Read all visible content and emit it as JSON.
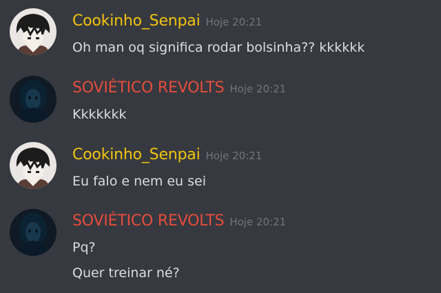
{
  "colors": {
    "background": "#36393f",
    "cookinho_name": "#f1c40f",
    "sovietico_name": "#e74c3c",
    "timestamp": "#72767d",
    "message_text": "#dcddde"
  },
  "messages": [
    {
      "author": "Cookinho_Senpai",
      "timestamp": "Hoje 20:21",
      "avatar_icon": "anime-boy-avatar-icon",
      "lines": [
        "Oh man oq significa rodar bolsinha?? kkkkkk"
      ]
    },
    {
      "author": "SOVIÉTICO REVOLTS",
      "timestamp": "Hoje 20:21",
      "avatar_icon": "dark-hooded-figure-avatar-icon",
      "lines": [
        "Kkkkkkk"
      ]
    },
    {
      "author": "Cookinho_Senpai",
      "timestamp": "Hoje 20:21",
      "avatar_icon": "anime-boy-avatar-icon",
      "lines": [
        "Eu falo e nem eu sei"
      ]
    },
    {
      "author": "SOVIÉTICO REVOLTS",
      "timestamp": "Hoje 20:21",
      "avatar_icon": "dark-hooded-figure-avatar-icon",
      "lines": [
        "Pq?",
        "Quer treinar né?"
      ]
    }
  ]
}
